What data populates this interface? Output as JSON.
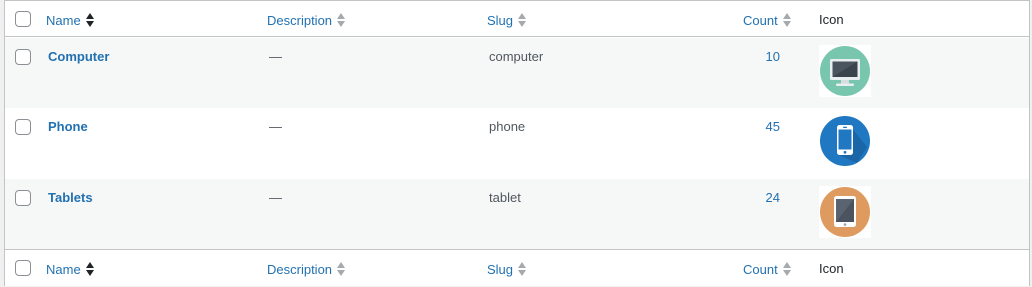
{
  "header": {
    "name_label": "Name",
    "description_label": "Description",
    "slug_label": "Slug",
    "count_label": "Count",
    "icon_label": "Icon"
  },
  "footer": {
    "name_label": "Name",
    "description_label": "Description",
    "slug_label": "Slug",
    "count_label": "Count",
    "icon_label": "Icon"
  },
  "rows": [
    {
      "name": "Computer",
      "description": "—",
      "slug": "computer",
      "count": "10",
      "icon": "computer-monitor-icon",
      "icon_bg": "#79c6ae"
    },
    {
      "name": "Phone",
      "description": "—",
      "slug": "phone",
      "count": "45",
      "icon": "smartphone-icon",
      "icon_bg": "#1f78c1"
    },
    {
      "name": "Tablets",
      "description": "—",
      "slug": "tablet",
      "count": "24",
      "icon": "tablet-icon",
      "icon_bg": "#df9a5f"
    }
  ],
  "colors": {
    "link": "#2271b1",
    "border": "#c3c4c7",
    "alt_row": "#f6f7f7"
  }
}
